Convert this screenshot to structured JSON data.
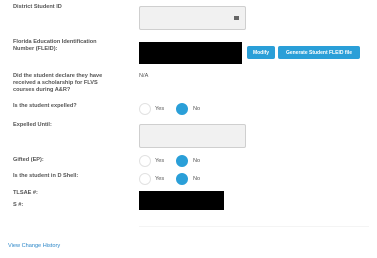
{
  "district_id": {
    "label": "District Student ID",
    "icon": "calendar-icon"
  },
  "fleid": {
    "label_line1": "Florida Education Identification",
    "label_line2": "Number (FLEID):",
    "modify_label": "Modify",
    "generate_label": "Generate Student FLEID file"
  },
  "scholarship": {
    "label_line1": "Did the student declare they have",
    "label_line2": "received a scholarship for FLVS",
    "label_line3": "courses during A&R?",
    "value": "N/A"
  },
  "expelled": {
    "label": "Is the student expelled?",
    "yes": "Yes",
    "no": "No",
    "selected": "No"
  },
  "expelled_until": {
    "label": "Expelled Until:"
  },
  "gifted": {
    "label": "Gifted (EP):",
    "yes": "Yes",
    "no": "No",
    "selected": "No"
  },
  "d_shell": {
    "label": "Is the student in D Shell:",
    "yes": "Yes",
    "no": "No",
    "selected": "No"
  },
  "tlsae": {
    "label": "TLSAE #:"
  },
  "s_number": {
    "label": "S #:"
  },
  "footer": {
    "view_history": "View Change History"
  },
  "colors": {
    "accent": "#2a9fd8",
    "link": "#2a86c8",
    "label": "#555555"
  }
}
